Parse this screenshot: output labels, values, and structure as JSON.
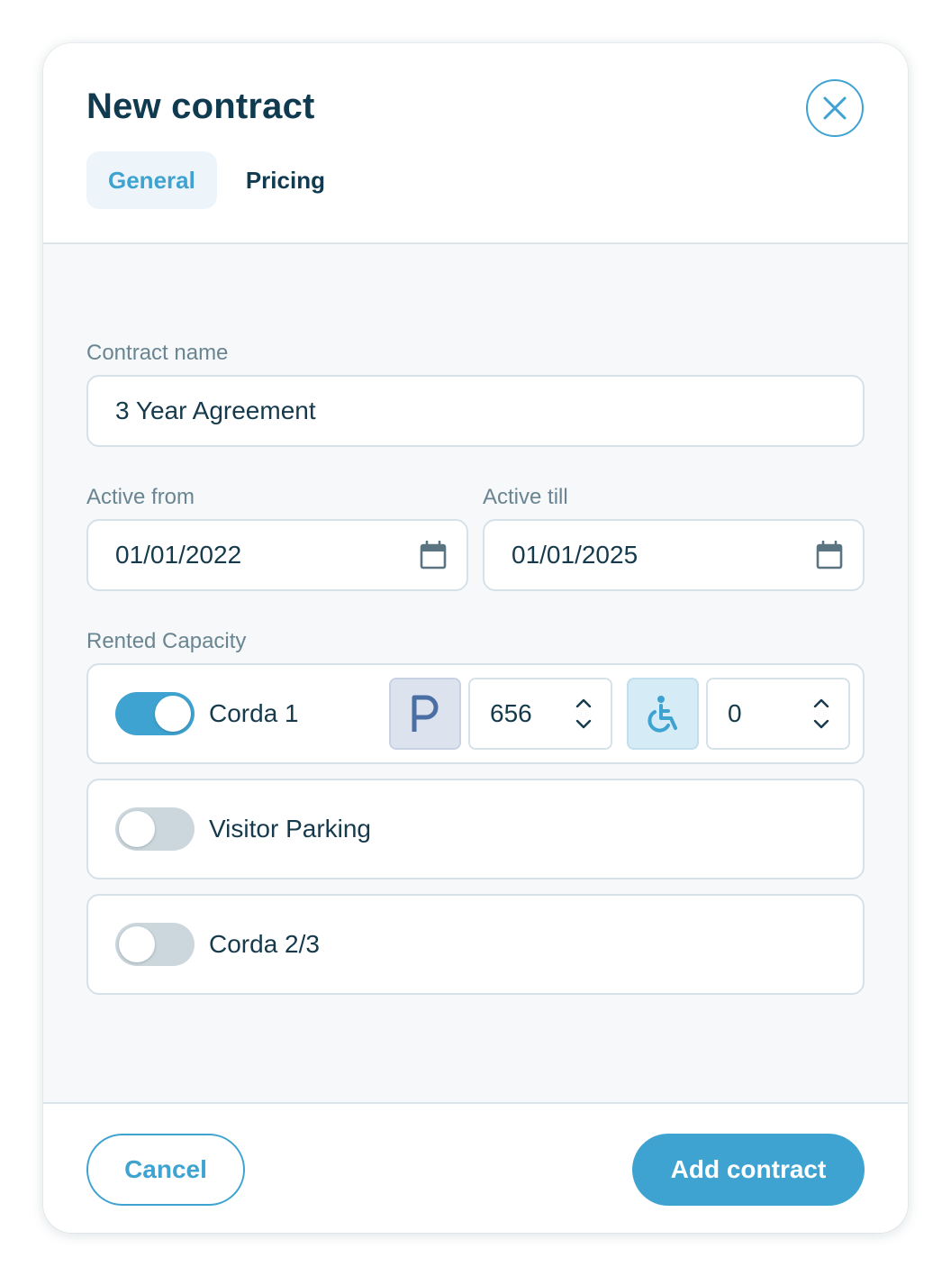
{
  "dialog": {
    "title": "New contract",
    "tabs": [
      {
        "label": "General",
        "active": true
      },
      {
        "label": "Pricing",
        "active": false
      }
    ]
  },
  "form": {
    "contract_name": {
      "label": "Contract name",
      "value": "3 Year Agreement"
    },
    "active_from": {
      "label": "Active from",
      "value": "01/01/2022"
    },
    "active_till": {
      "label": "Active till",
      "value": "01/01/2025"
    },
    "rented_capacity": {
      "label": "Rented Capacity",
      "items": [
        {
          "name": "Corda 1",
          "enabled": true,
          "parking_spots": "656",
          "accessible_spots": "0"
        },
        {
          "name": "Visitor Parking",
          "enabled": false
        },
        {
          "name": "Corda 2/3",
          "enabled": false
        }
      ]
    }
  },
  "actions": {
    "cancel_label": "Cancel",
    "submit_label": "Add contract"
  },
  "icons": {
    "close": "close-icon",
    "calendar": "calendar-icon",
    "parking": "parking-icon",
    "accessible": "wheelchair-icon",
    "up": "chevron-up-icon",
    "down": "chevron-down-icon"
  },
  "colors": {
    "accent": "#3fa3d1",
    "title": "#0f3a4f",
    "muted": "#6a8592",
    "parking_badge": "#dce3ef",
    "parking_glyph": "#4a6fa5",
    "accessible_badge": "#d5ebf6"
  }
}
